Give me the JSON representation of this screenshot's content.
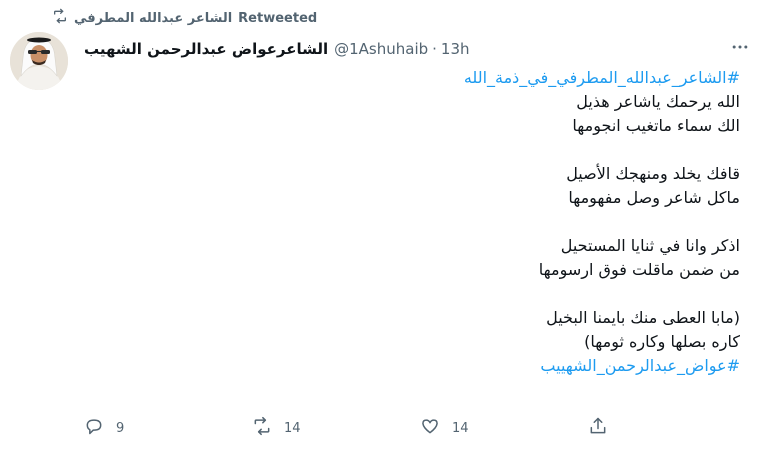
{
  "retweet_banner": {
    "retweeter": "الشاعر عبدالله المطرفي",
    "label": "Retweeted"
  },
  "tweet": {
    "author_name": "الشاعرعواض عبدالرحمن الشهيب",
    "handle": "@1Ashuhaib",
    "separator": "·",
    "time": "13h",
    "lines": {
      "hashtag1": "#الشاعر_عبدالله_المطرفي_في_ذمة_الله",
      "l1": "الله يرحمك ياشاعر هذيل",
      "l2": "الك سماء ماتغيب انجومها",
      "l3": "قافك يخلد ومنهجك الأصيل",
      "l4": "ماكل شاعر وصل مفهومها",
      "l5": "اذكر وانا في ثنايا المستحيل",
      "l6": "من ضمن ماقلت فوق ارسومها",
      "l7": "(مابا العطى منك بايمنا البخيل",
      "l8": "كاره بصلها وكاره ثومها)",
      "hashtag2": "#عواض_عبدالرحمن_الشهييب"
    },
    "stats": {
      "replies": "9",
      "retweets": "14",
      "likes": "14"
    }
  },
  "icons": {
    "retweet_banner": "retweet-icon",
    "more": "more-icon",
    "reply": "reply-icon",
    "retweet": "retweet-icon",
    "like": "heart-icon",
    "share": "share-icon"
  },
  "colors": {
    "hashtag": "#1d9bf0",
    "muted": "#536471",
    "text": "#0f1419"
  }
}
